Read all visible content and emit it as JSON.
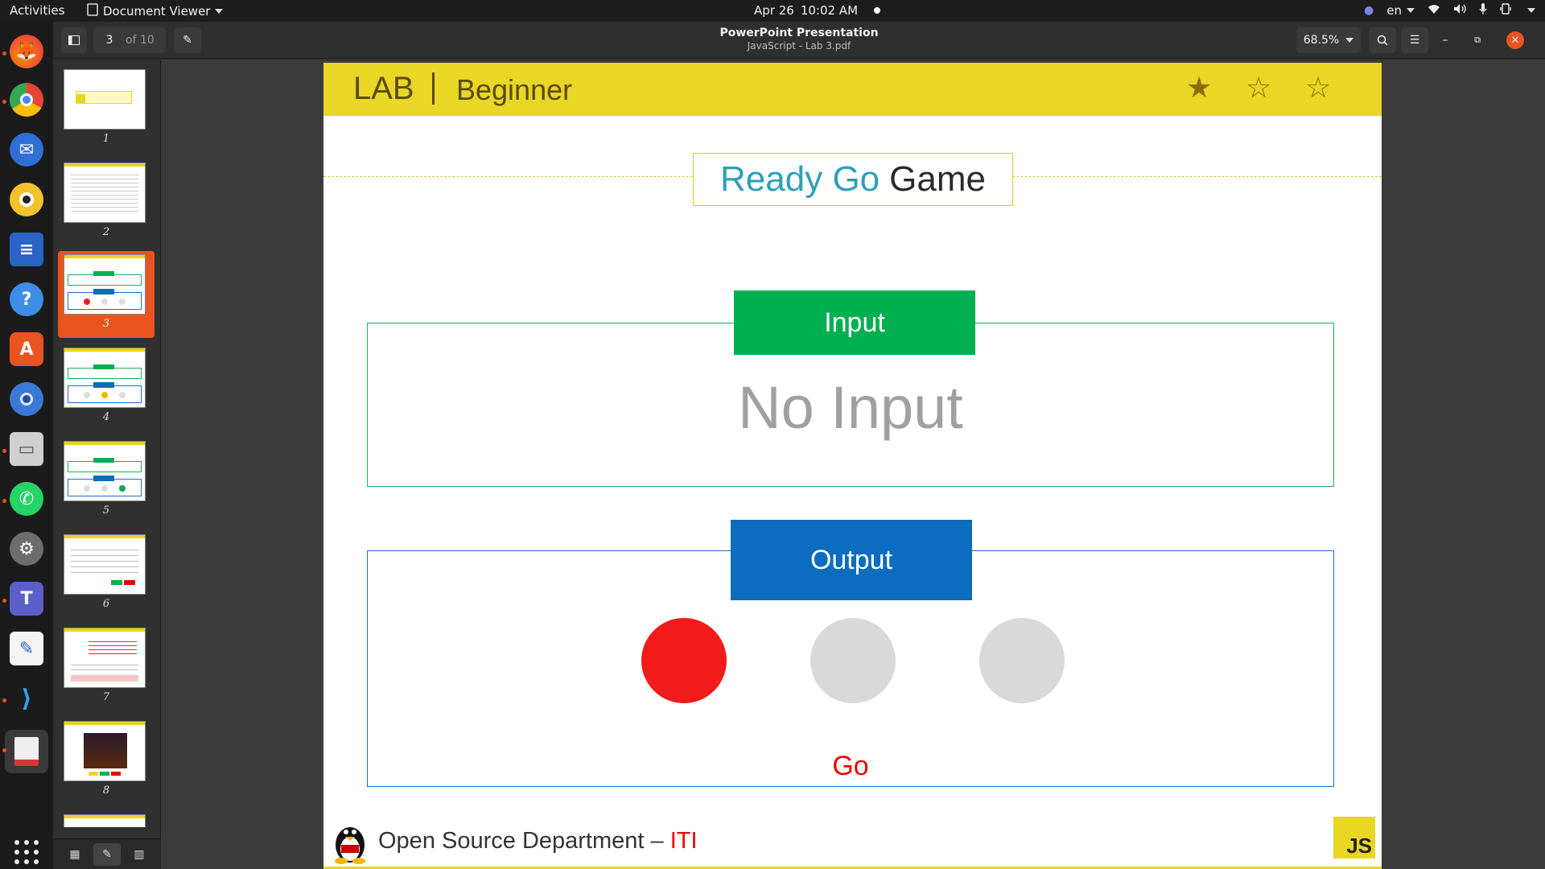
{
  "topbar": {
    "activities": "Activities",
    "app_name": "Document Viewer",
    "date": "Apr 26",
    "time": "10:02 AM",
    "language": "en"
  },
  "dock": {
    "apps": [
      "firefox-icon",
      "chrome-icon",
      "thunderbird-icon",
      "rhythmbox-icon",
      "writer-icon",
      "help-icon",
      "software-icon",
      "chromium-icon",
      "files-icon",
      "whatsapp-icon",
      "settings-icon",
      "teams-icon",
      "text-editor-icon",
      "vscode-icon",
      "document-viewer-icon"
    ]
  },
  "headerbar": {
    "page_current": "3",
    "page_total": "of 10",
    "title": "PowerPoint Presentation",
    "subtitle": "JavaScript - Lab 3.pdf",
    "zoom": "68.5%"
  },
  "sidebar": {
    "thumbnails": [
      {
        "num": "1"
      },
      {
        "num": "2"
      },
      {
        "num": "3"
      },
      {
        "num": "4"
      },
      {
        "num": "5"
      },
      {
        "num": "6"
      },
      {
        "num": "7"
      },
      {
        "num": "8"
      }
    ],
    "active_page": 3
  },
  "slide": {
    "lab": "LAB",
    "level": "Beginner",
    "stars_filled": 1,
    "stars_total": 3,
    "title_part1": "Ready Go",
    "title_part2": "Game",
    "input_label": "Input",
    "input_value": "No Input",
    "output_label": "Output",
    "lights": [
      "#f21b1b",
      "#d9d9d9",
      "#d9d9d9"
    ],
    "status": "Go",
    "footer_dept": "Open Source Department – ",
    "footer_org": "ITI",
    "js_badge": "JS"
  },
  "colors": {
    "accent_yellow": "#e9d625",
    "input_green": "#00b050",
    "output_blue": "#0b6cc0",
    "active_orange": "#e95420"
  }
}
